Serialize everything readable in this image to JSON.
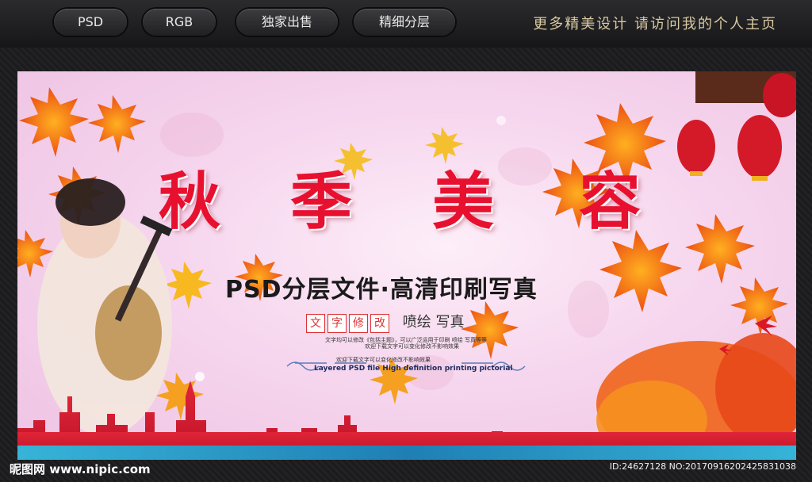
{
  "top_nav": {
    "pills": [
      "PSD",
      "RGB",
      "独家出售",
      "精细分层"
    ],
    "slogan": "更多精美设计 请访问我的个人主页"
  },
  "poster": {
    "title_chars": [
      "秋",
      "季",
      "美",
      "容"
    ],
    "subtitle": "PSD分层文件·高清印刷写真",
    "edit_chars": [
      "文",
      "字",
      "修",
      "改"
    ],
    "edit_rest": "喷绘 写真",
    "note_line1": "文字均可以修改《包括主题》，可以广泛运用于印刷 喷绘 写真等等",
    "note_line2": "欢迎下载文字可以变化修改不影响效果",
    "note_line3": "欢迎下载文字可以变化修改不影响效果",
    "english_line": "Layered PSD file High definition printing pictorial",
    "colors": {
      "title": "#e8102f",
      "leaf": "#f05a12",
      "background": "#f6d6ee",
      "skyline": "#d8182e"
    }
  },
  "footer": {
    "watermark": "昵图网 www.nipic.com",
    "id_text": "ID:24627128 NO:20170916202425831038"
  }
}
